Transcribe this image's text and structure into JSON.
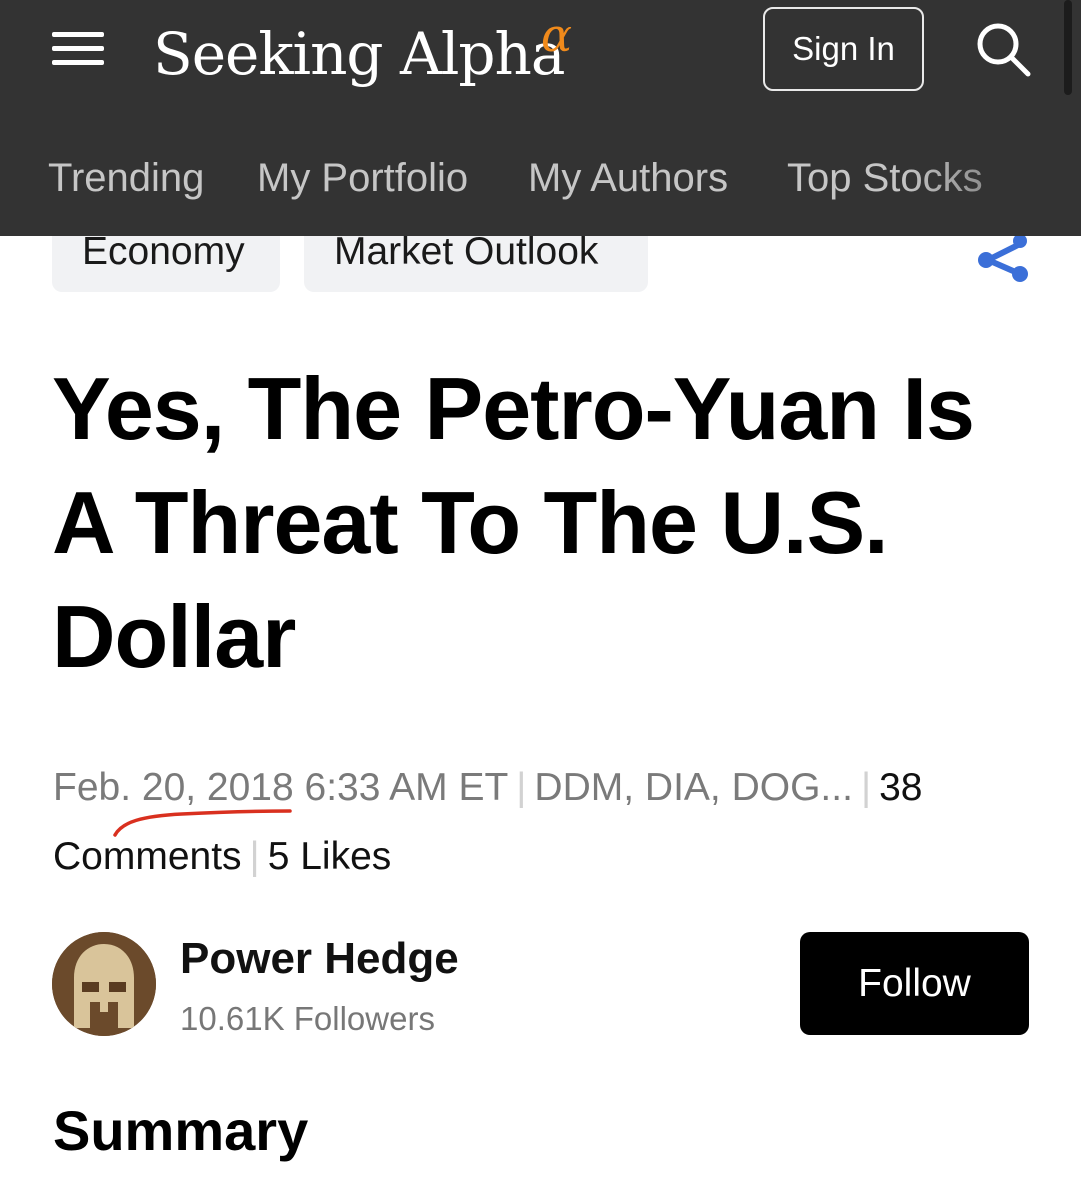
{
  "header": {
    "logo_text": "Seeking Alpha",
    "logo_symbol": "α",
    "sign_in_label": "Sign In",
    "nav": [
      "Trending",
      "My Portfolio",
      "My Authors",
      "Top Stocks"
    ],
    "colors": {
      "background": "#333333",
      "alpha_accent": "#f08a1b"
    }
  },
  "tags": [
    "Economy",
    "Market Outlook"
  ],
  "article": {
    "title": "Yes, The Petro-Yuan Is A Threat To The U.S. Dollar",
    "date": "Feb. 20, 2018 6:33 AM ET",
    "tickers": "DDM, DIA, DOG...",
    "comments": "38 Comments",
    "likes": "5 Likes"
  },
  "author": {
    "name": "Power Hedge",
    "followers": "10.61K Followers",
    "follow_label": "Follow"
  },
  "section_heading": "Summary",
  "icons": {
    "menu": "hamburger-menu-icon",
    "search": "search-icon",
    "share": "share-icon"
  },
  "colors": {
    "share_blue": "#3b6fd8",
    "annotation_red": "#d9301f"
  }
}
